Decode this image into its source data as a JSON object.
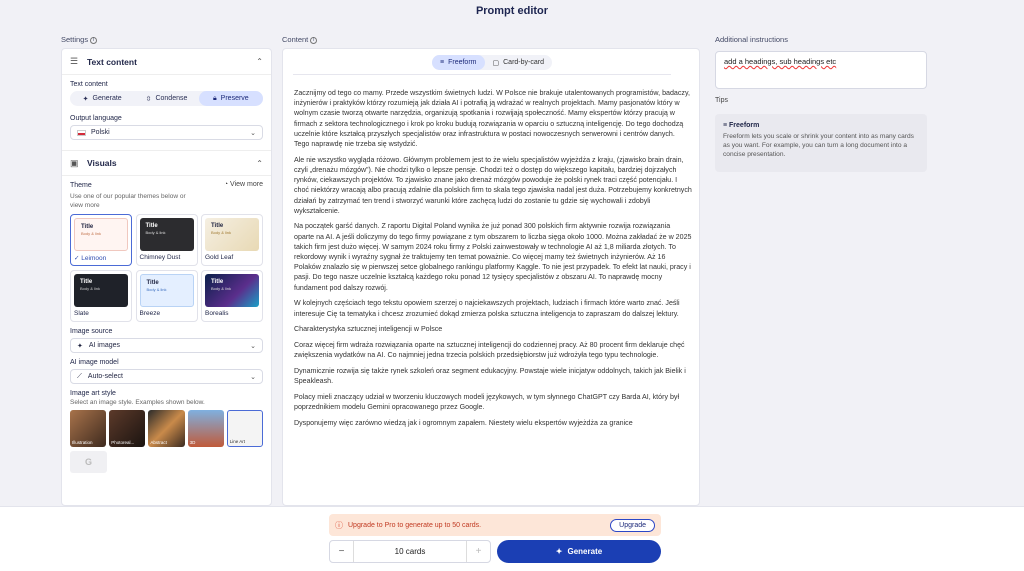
{
  "title": "Prompt editor",
  "labels": {
    "settings": "Settings",
    "content": "Content",
    "additional": "Additional instructions",
    "tips": "Tips"
  },
  "settings": {
    "text_content_section": "Text content",
    "text_content_label": "Text content",
    "modes": [
      "Generate",
      "Condense",
      "Preserve"
    ],
    "active_mode": "Preserve",
    "output_language_label": "Output language",
    "output_language": "Polski",
    "visuals_section": "Visuals",
    "theme_label": "Theme",
    "theme_sub": "Use one of our popular themes below or view more",
    "view_more": "View more",
    "themes": [
      {
        "name": "Leimoon",
        "selected": true
      },
      {
        "name": "Chimney Dust",
        "selected": false
      },
      {
        "name": "Gold Leaf",
        "selected": false
      },
      {
        "name": "Slate",
        "selected": false
      },
      {
        "name": "Breeze",
        "selected": false
      },
      {
        "name": "Borealis",
        "selected": false
      }
    ],
    "theme_preview_title": "Title",
    "theme_preview_body": "Body & link",
    "image_source_label": "Image source",
    "image_source": "AI images",
    "ai_model_label": "AI image model",
    "ai_model": "Auto-select",
    "art_style_label": "Image art style",
    "art_style_sub": "Select an image style. Examples shown below.",
    "art_styles": [
      "Illustration",
      "Photoreal...",
      "Abstract",
      "3D",
      "Line Art"
    ]
  },
  "content": {
    "tabs": [
      "Freeform",
      "Card-by-card"
    ],
    "active_tab": "Freeform",
    "paragraphs": [
      "Zacznijmy od tego co mamy. Przede wszystkim świetnych ludzi. W Polsce nie brakuje utalentowanych programistów, badaczy, inżynierów i praktyków którzy rozumieją jak działa AI i potrafią ją wdrażać w realnych projektach. Mamy pasjonatów który w wolnym czasie tworzą otwarte narzędzia, organizują spotkania i rozwijają społeczność. Mamy ekspertów którzy pracują w firmach z sektora technologicznego i krok po kroku budują rozwiązania w oparciu o sztuczną inteligencję. Do tego dochodzą uczelnie które kształcą przyszłych specjalistów oraz infrastruktura w postaci nowoczesnych serwerowni i centrów danych. Tego naprawdę nie trzeba się wstydzić.",
      "Ale nie wszystko wygląda różowo. Głównym problemem jest to że wielu specjalistów wyjeżdża z kraju, (zjawisko brain drain, czyli „drenażu mózgów”). Nie chodzi tylko o lepsze pensje. Chodzi też o dostęp do większego kapitału, bardziej dojrzałych rynków, ciekawszych projektów. To zjawisko znane jako drenaż mózgów powoduje że polski rynek traci część potencjału. I choć niektórzy wracają albo pracują zdalnie dla polskich firm to skala tego zjawiska nadal jest duża. Potrzebujemy konkretnych działań by zatrzymać ten trend i stworzyć warunki które zachęcą ludzi do zostanie tu gdzie się wychowali i zdobyli wykształcenie.",
      "Na początek garść danych. Z raportu Digital Poland wynika że już ponad 300 polskich firm aktywnie rozwija rozwiązania oparte na AI. A jeśli doliczymy do tego firmy powiązane z tym obszarem to liczba sięga około 1000. Można zakładać że w 2025 takich firm jest dużo więcej. W samym 2024 roku firmy z Polski zainwestowały w technologie AI aż 1,8 miliarda złotych. To rekordowy wynik i wyraźny sygnał że traktujemy ten temat poważnie. Co więcej mamy też świetnych inżynierów. Aż 16 Polaków znalazło się w pierwszej setce globalnego rankingu platformy Kaggle. To nie jest przypadek. To efekt lat nauki, pracy i pasji. Do tego nasze uczelnie kształcą każdego roku ponad 12 tysięcy specjalistów z obszaru AI. To naprawdę mocny fundament pod dalszy rozwój.",
      "W kolejnych częściach tego tekstu opowiem szerzej o najciekawszych projektach, ludziach i firmach które warto znać. Jeśli interesuje Cię ta tematyka i chcesz zrozumieć dokąd zmierza polska sztuczna inteligencja to zapraszam do dalszej lektury.",
      "Charakterystyka sztucznej inteligencji w Polsce",
      "Coraz więcej firm wdraża rozwiązania oparte na sztucznej inteligencji do codziennej pracy. Aż 80 procent firm deklaruje chęć zwiększenia wydatków na AI. Co najmniej jedna trzecia polskich przedsiębiorstw już wdrożyła tego typu technologie.",
      "Dynamicznie rozwija się także rynek szkoleń oraz segment edukacyjny. Powstaje wiele inicjatyw oddolnych, takich jak Bielik i Speakleash.",
      "Polacy mieli znaczący udział w tworzeniu kluczowych modeli językowych, w tym słynnego ChatGPT czy Barda AI, który był poprzednikiem modelu Gemini opracowanego przez Google.",
      "Dysponujemy więc zarówno wiedzą jak i ogromnym zapałem. Niestety wielu ekspertów wyjeżdża za granice"
    ]
  },
  "additional_instructions": "add a headings, sub headings etc",
  "tip": {
    "title": "Freeform",
    "body": "Freeform lets you scale or shrink your content into as many cards as you want. For example, you can turn a long document into a concise presentation."
  },
  "footer": {
    "upgrade_message": "Upgrade to Pro to generate up to 50 cards.",
    "upgrade_button": "Upgrade",
    "cards_value": "10 cards",
    "generate_label": "Generate"
  },
  "colors": {
    "accent": "#1b3fb4",
    "warning_bg": "#fde6d8",
    "warning_text": "#c13a22"
  }
}
